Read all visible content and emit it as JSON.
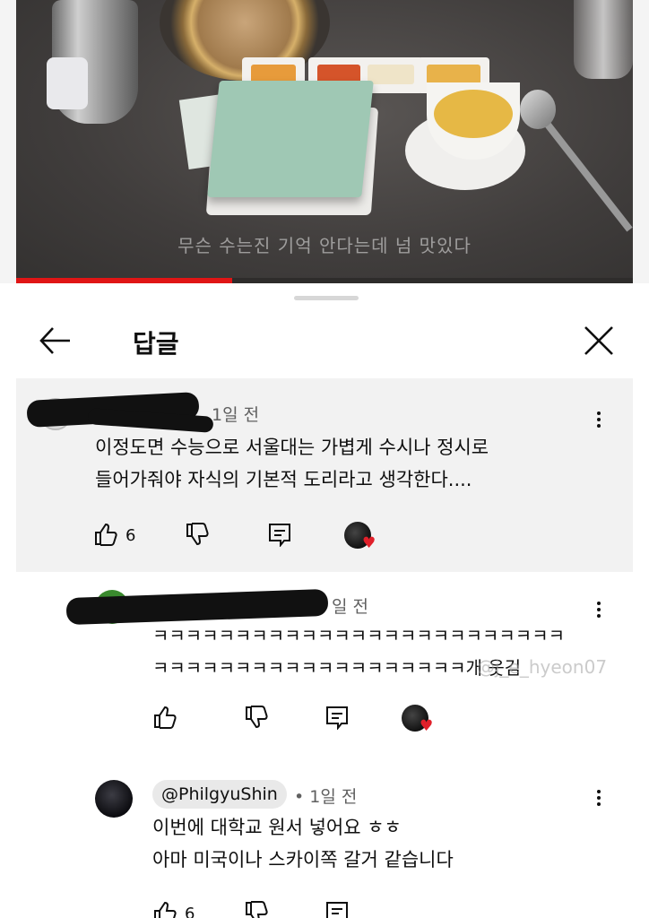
{
  "video": {
    "subtitle": "무슨 수는진 기억 안다는데 넘 맛있다",
    "progress_fraction": 0.35
  },
  "panel": {
    "title": "답글",
    "back_icon": "arrow-left-icon",
    "close_icon": "close-icon"
  },
  "comments": [
    {
      "time": "1일 전",
      "lines": [
        "이정도면 수능으로 서울대는 가볍게 수시나 정시로",
        "들어가줘야 자식의 기본적 도리라고 생각한다...."
      ],
      "likes": "6"
    },
    {
      "time": "일 전",
      "lines": [
        "ㅋㅋㅋㅋㅋㅋㅋㅋㅋㅋㅋㅋㅋㅋㅋㅋㅋㅋㅋㅋㅋㅋㅋㅋㅋ",
        "ㅋㅋㅋㅋㅋㅋㅋㅋㅋㅋㅋㅋㅋㅋㅋㅋㅋㅋㅋ개 웃김"
      ],
      "likes": ""
    },
    {
      "handle": "@PhilgyuShin",
      "time": "• 1일 전",
      "lines": [
        "이번에 대학교 원서 넣어요 ㅎㅎ",
        "아마 미국이나 스카이쪽 갈거 같습니다"
      ],
      "likes": "6"
    }
  ],
  "watermark": "@j_e_hyeon07",
  "colors": {
    "heart": "#e0202a",
    "progress": "#e01515",
    "highlight_bg": "#f2f2f2"
  }
}
